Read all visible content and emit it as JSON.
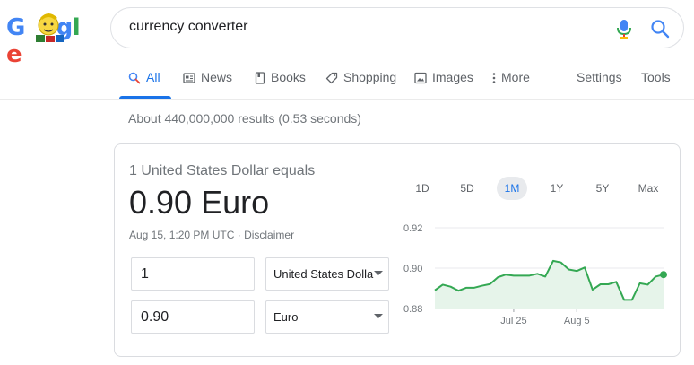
{
  "search": {
    "query": "currency converter"
  },
  "tabs": [
    {
      "label": "All",
      "icon": "search-icon",
      "active": true
    },
    {
      "label": "News",
      "icon": "news-icon"
    },
    {
      "label": "Books",
      "icon": "book-icon"
    },
    {
      "label": "Shopping",
      "icon": "tag-icon"
    },
    {
      "label": "Images",
      "icon": "image-icon"
    },
    {
      "label": "More",
      "icon": "more-vertical-icon"
    }
  ],
  "tools": {
    "settings": "Settings",
    "tools": "Tools"
  },
  "result_stats": "About 440,000,000 results (0.53 seconds)",
  "converter": {
    "equals_label": "1 United States Dollar equals",
    "result": "0.90 Euro",
    "timestamp": "Aug 15, 1:20 PM UTC · ",
    "disclaimer": "Disclaimer",
    "from_amount": "1",
    "from_currency": "United States Dollar",
    "to_amount": "0.90",
    "to_currency": "Euro"
  },
  "ranges": [
    "1D",
    "5D",
    "1M",
    "1Y",
    "5Y",
    "Max"
  ],
  "active_range": "1M",
  "colors": {
    "accent": "#1a73e8",
    "chart_line": "#34a853",
    "chart_fill": "#e6f4ea"
  },
  "chart_data": {
    "type": "area",
    "title": "",
    "xlabel": "",
    "ylabel": "",
    "ylim": [
      0.88,
      0.92
    ],
    "yticks": [
      "0.92",
      "0.90",
      "0.88"
    ],
    "ytick_values": [
      0.92,
      0.9,
      0.88
    ],
    "xticks": [
      "Jul 25",
      "Aug 5"
    ],
    "xtick_index": [
      10,
      18
    ],
    "series": [
      {
        "values": [
          0.889,
          0.8918,
          0.8908,
          0.8888,
          0.8903,
          0.8903,
          0.8913,
          0.8921,
          0.8955,
          0.8968,
          0.8963,
          0.8963,
          0.8963,
          0.8972,
          0.8958,
          0.9036,
          0.9028,
          0.8993,
          0.8986,
          0.9003,
          0.8893,
          0.892,
          0.892,
          0.8932,
          0.8843,
          0.8843,
          0.8925,
          0.8918,
          0.8958,
          0.8968
        ]
      }
    ],
    "grid": true
  }
}
